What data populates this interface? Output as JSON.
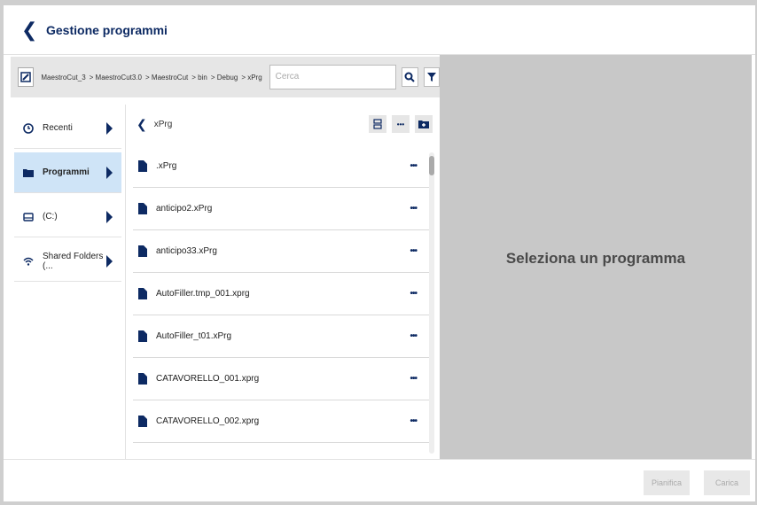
{
  "header": {
    "title": "Gestione programmi"
  },
  "toolbar": {
    "breadcrumbs": [
      "MaestroCut_3",
      "> MaestroCut3.0",
      "> MaestroCut",
      "> bin",
      "> Debug",
      "> xPrg"
    ],
    "search_placeholder": "Cerca"
  },
  "nav": {
    "items": [
      {
        "label": "Recenti",
        "icon": "clock-icon"
      },
      {
        "label": "Programmi",
        "icon": "folder-icon"
      },
      {
        "label": "(C:)",
        "icon": "drive-icon"
      },
      {
        "label": "Shared Folders (...",
        "icon": "wifi-icon"
      }
    ]
  },
  "list": {
    "path": "xPrg",
    "files": [
      ".xPrg",
      "anticipo2.xPrg",
      "anticipo33.xPrg",
      "AutoFiller.tmp_001.xprg",
      "AutoFiller_t01.xPrg",
      "CATAVORELLO_001.xprg",
      "CATAVORELLO_002.xprg"
    ],
    "more_label": "•••"
  },
  "preview": {
    "message": "Seleziona un programma"
  },
  "footer": {
    "plan_label": "Pianifica",
    "load_label": "Carica"
  },
  "colors": {
    "accent": "#0d2a63",
    "selected": "#cfe4f7",
    "preview_bg": "#c8c8c8"
  }
}
